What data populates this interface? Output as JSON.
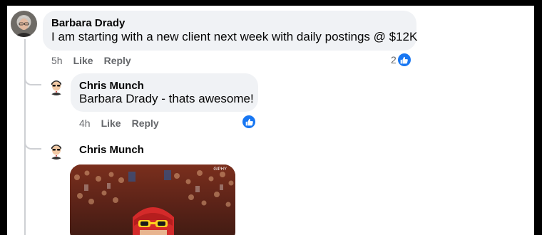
{
  "comments": [
    {
      "author": "Barbara Drady",
      "text": "I am starting with a new client next week with daily postings @ $12K",
      "time": "5h",
      "like_label": "Like",
      "reply_label": "Reply",
      "reaction_count": "2",
      "reaction_icon": "like-icon"
    }
  ],
  "replies": [
    {
      "author": "Chris Munch",
      "mention": "Barbara Drady",
      "text": " - thats awesome!",
      "time": "4h",
      "like_label": "Like",
      "reply_label": "Reply",
      "reaction_icon": "like-icon"
    },
    {
      "author": "Chris Munch",
      "attachment": "gif",
      "gif_watermark": "GIPHY"
    }
  ],
  "colors": {
    "like_blue": "#1877f2",
    "bubble_bg": "#f0f2f5",
    "meta_text": "#65676b",
    "thread_line": "#ced0d4"
  }
}
